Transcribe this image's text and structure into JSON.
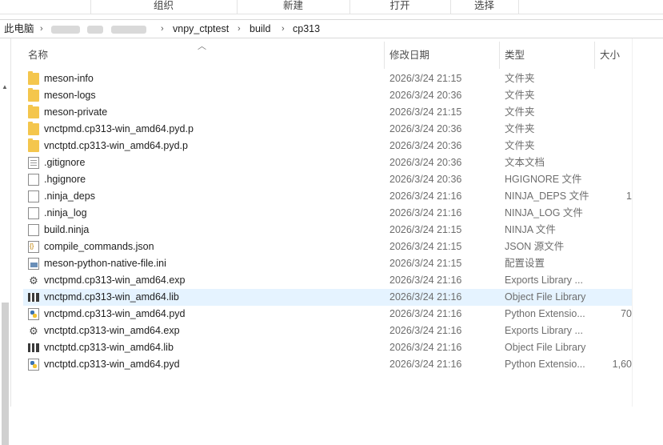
{
  "ribbon": {
    "groups": [
      "组织",
      "新建",
      "打开",
      "选择"
    ]
  },
  "address": {
    "root": "此电脑",
    "crumbs": [
      "vnpy_ctptest",
      "build",
      "cp313"
    ]
  },
  "columns": {
    "name": "名称",
    "date": "修改日期",
    "type": "类型",
    "size": "大小"
  },
  "files": [
    {
      "name": "meson-info",
      "date": "2026/3/24 21:15",
      "type": "文件夹",
      "size": "",
      "icon": "folder-icon"
    },
    {
      "name": "meson-logs",
      "date": "2026/3/24 20:36",
      "type": "文件夹",
      "size": "",
      "icon": "folder-icon"
    },
    {
      "name": "meson-private",
      "date": "2026/3/24 21:15",
      "type": "文件夹",
      "size": "",
      "icon": "folder-icon"
    },
    {
      "name": "vnctpmd.cp313-win_amd64.pyd.p",
      "date": "2026/3/24 20:36",
      "type": "文件夹",
      "size": "",
      "icon": "folder-icon"
    },
    {
      "name": "vnctptd.cp313-win_amd64.pyd.p",
      "date": "2026/3/24 20:36",
      "type": "文件夹",
      "size": "",
      "icon": "folder-icon"
    },
    {
      "name": ".gitignore",
      "date": "2026/3/24 20:36",
      "type": "文本文档",
      "size": "",
      "icon": "text-file-icon"
    },
    {
      "name": ".hgignore",
      "date": "2026/3/24 20:36",
      "type": "HGIGNORE 文件",
      "size": "",
      "icon": "blank-file-icon"
    },
    {
      "name": ".ninja_deps",
      "date": "2026/3/24 21:16",
      "type": "NINJA_DEPS 文件",
      "size": "1",
      "icon": "blank-file-icon"
    },
    {
      "name": ".ninja_log",
      "date": "2026/3/24 21:16",
      "type": "NINJA_LOG 文件",
      "size": "",
      "icon": "blank-file-icon"
    },
    {
      "name": "build.ninja",
      "date": "2026/3/24 21:15",
      "type": "NINJA 文件",
      "size": "",
      "icon": "blank-file-icon"
    },
    {
      "name": "compile_commands.json",
      "date": "2026/3/24 21:15",
      "type": "JSON 源文件",
      "size": "",
      "icon": "json-file-icon"
    },
    {
      "name": "meson-python-native-file.ini",
      "date": "2026/3/24 21:15",
      "type": "配置设置",
      "size": "",
      "icon": "ini-file-icon"
    },
    {
      "name": "vnctpmd.cp313-win_amd64.exp",
      "date": "2026/3/24 21:16",
      "type": "Exports Library ...",
      "size": "",
      "icon": "gear-file-icon"
    },
    {
      "name": "vnctpmd.cp313-win_amd64.lib",
      "date": "2026/3/24 21:16",
      "type": "Object File Library",
      "size": "",
      "icon": "library-icon",
      "selected": true
    },
    {
      "name": "vnctpmd.cp313-win_amd64.pyd",
      "date": "2026/3/24 21:16",
      "type": "Python Extensio...",
      "size": "70",
      "icon": "python-file-icon"
    },
    {
      "name": "vnctptd.cp313-win_amd64.exp",
      "date": "2026/3/24 21:16",
      "type": "Exports Library ...",
      "size": "",
      "icon": "gear-file-icon"
    },
    {
      "name": "vnctptd.cp313-win_amd64.lib",
      "date": "2026/3/24 21:16",
      "type": "Object File Library",
      "size": "",
      "icon": "library-icon"
    },
    {
      "name": "vnctptd.cp313-win_amd64.pyd",
      "date": "2026/3/24 21:16",
      "type": "Python Extensio...",
      "size": "1,60",
      "icon": "python-file-icon"
    }
  ]
}
